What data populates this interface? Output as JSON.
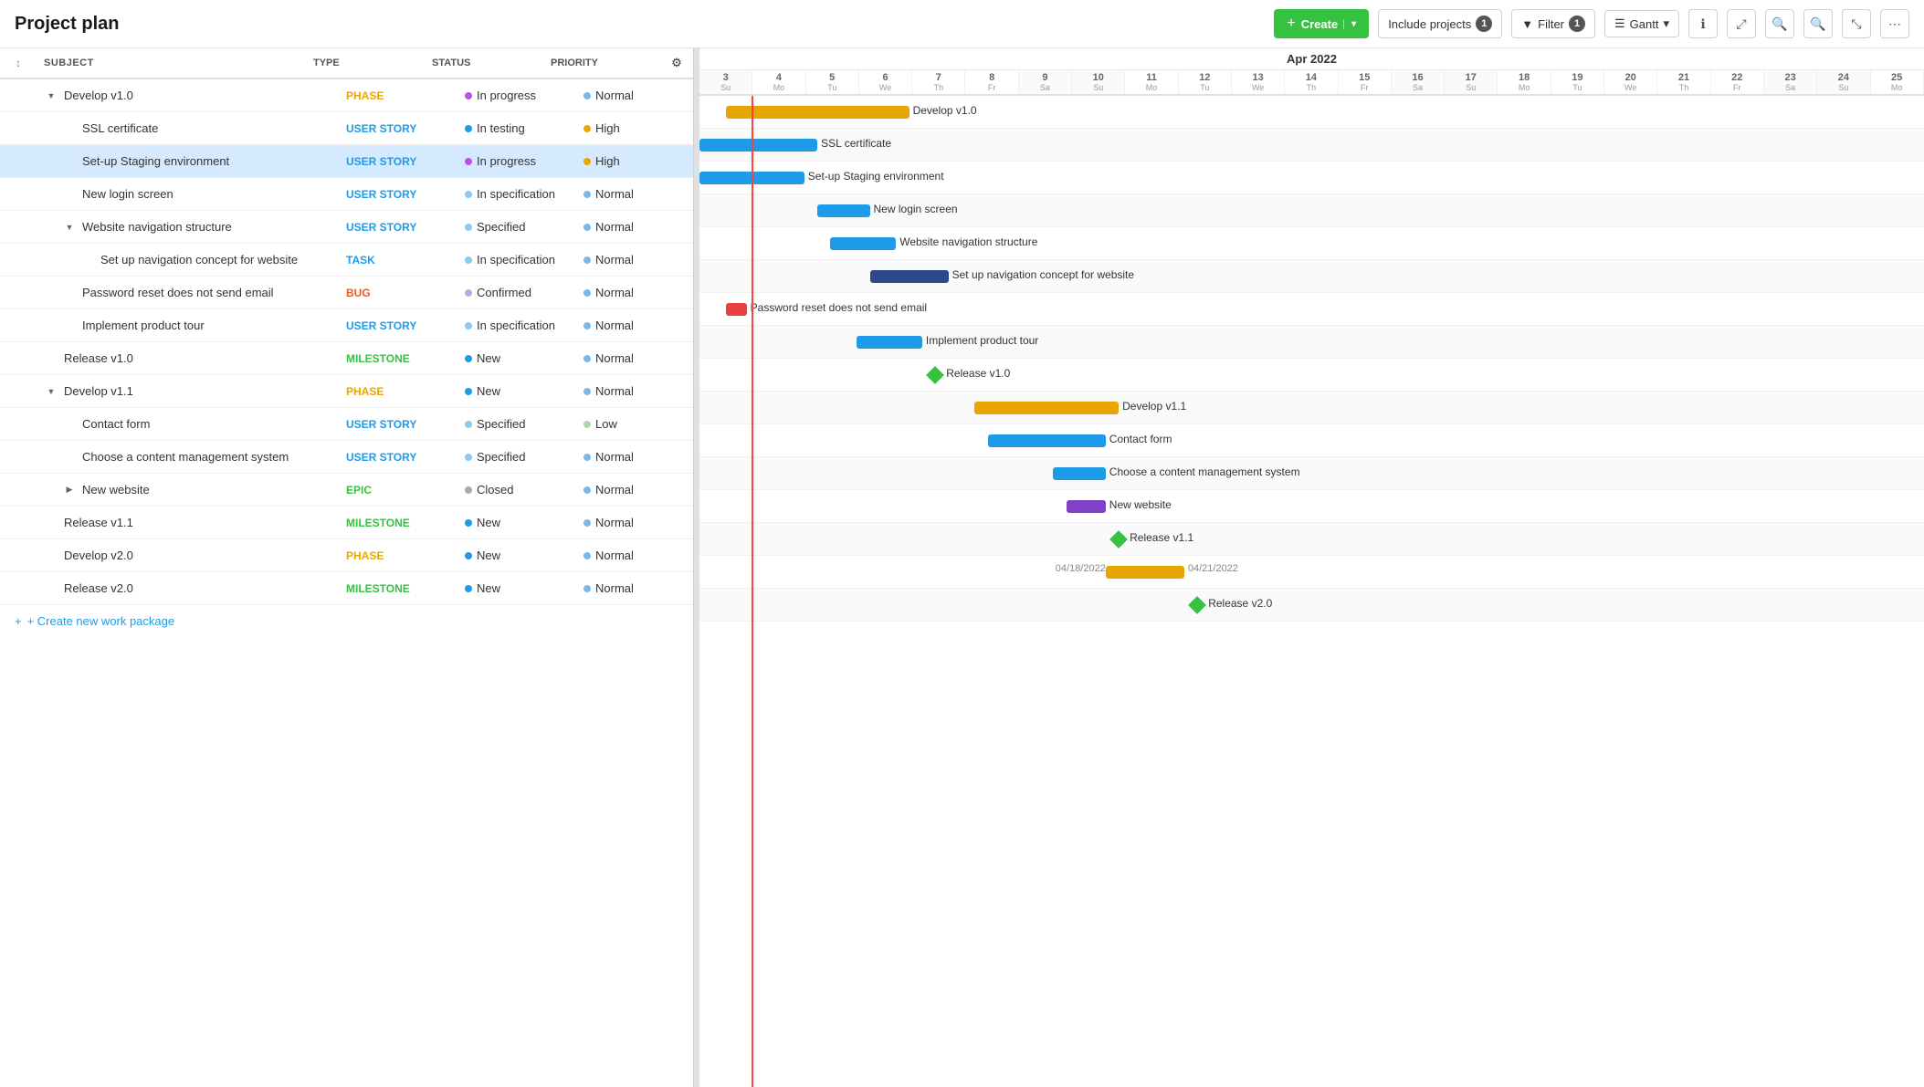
{
  "header": {
    "title": "Project plan",
    "create_label": "+ Create",
    "include_projects_label": "Include projects",
    "include_projects_count": "1",
    "filter_label": "Filter",
    "filter_count": "1",
    "gantt_label": "Gantt"
  },
  "columns": {
    "subject": "SUBJECT",
    "type": "TYPE",
    "status": "STATUS",
    "priority": "PRIORITY"
  },
  "tasks": [
    {
      "id": 1,
      "indent": 0,
      "toggle": "▼",
      "subject": "Develop v1.0",
      "type": "PHASE",
      "type_class": "type-phase",
      "status": "In progress",
      "status_dot": "status-dot-inprogress",
      "priority": "Normal",
      "priority_dot": "priority-normal",
      "selected": false
    },
    {
      "id": 2,
      "indent": 1,
      "toggle": "",
      "subject": "SSL certificate",
      "type": "USER STORY",
      "type_class": "type-user-story",
      "status": "In testing",
      "status_dot": "status-dot-intesting",
      "priority": "High",
      "priority_dot": "priority-high",
      "selected": false
    },
    {
      "id": 3,
      "indent": 1,
      "toggle": "",
      "subject": "Set-up Staging environment",
      "type": "USER STORY",
      "type_class": "type-user-story",
      "status": "In progress",
      "status_dot": "status-dot-inprogress",
      "priority": "High",
      "priority_dot": "priority-high",
      "selected": true
    },
    {
      "id": 4,
      "indent": 1,
      "toggle": "",
      "subject": "New login screen",
      "type": "USER STORY",
      "type_class": "type-user-story",
      "status": "In specification",
      "status_dot": "status-dot-inspec",
      "priority": "Normal",
      "priority_dot": "priority-normal",
      "selected": false
    },
    {
      "id": 5,
      "indent": 1,
      "toggle": "▼",
      "subject": "Website navigation structure",
      "type": "USER STORY",
      "type_class": "type-user-story",
      "status": "Specified",
      "status_dot": "status-dot-specified",
      "priority": "Normal",
      "priority_dot": "priority-normal",
      "selected": false
    },
    {
      "id": 6,
      "indent": 2,
      "toggle": "",
      "subject": "Set up navigation concept for website",
      "type": "TASK",
      "type_class": "type-task",
      "status": "In specification",
      "status_dot": "status-dot-inspec",
      "priority": "Normal",
      "priority_dot": "priority-normal",
      "selected": false
    },
    {
      "id": 7,
      "indent": 1,
      "toggle": "",
      "subject": "Password reset does not send email",
      "type": "BUG",
      "type_class": "type-bug",
      "status": "Confirmed",
      "status_dot": "status-dot-confirmed",
      "priority": "Normal",
      "priority_dot": "priority-normal",
      "selected": false
    },
    {
      "id": 8,
      "indent": 1,
      "toggle": "",
      "subject": "Implement product tour",
      "type": "USER STORY",
      "type_class": "type-user-story",
      "status": "In specification",
      "status_dot": "status-dot-inspec",
      "priority": "Normal",
      "priority_dot": "priority-normal",
      "selected": false
    },
    {
      "id": 9,
      "indent": 0,
      "toggle": "",
      "subject": "Release v1.0",
      "type": "MILESTONE",
      "type_class": "type-milestone",
      "status": "New",
      "status_dot": "status-dot-new",
      "priority": "Normal",
      "priority_dot": "priority-normal",
      "selected": false
    },
    {
      "id": 10,
      "indent": 0,
      "toggle": "▼",
      "subject": "Develop v1.1",
      "type": "PHASE",
      "type_class": "type-phase",
      "status": "New",
      "status_dot": "status-dot-new",
      "priority": "Normal",
      "priority_dot": "priority-normal",
      "selected": false
    },
    {
      "id": 11,
      "indent": 1,
      "toggle": "",
      "subject": "Contact form",
      "type": "USER STORY",
      "type_class": "type-user-story",
      "status": "Specified",
      "status_dot": "status-dot-specified",
      "priority": "Low",
      "priority_dot": "priority-low",
      "selected": false
    },
    {
      "id": 12,
      "indent": 1,
      "toggle": "",
      "subject": "Choose a content management system",
      "type": "USER STORY",
      "type_class": "type-user-story",
      "status": "Specified",
      "status_dot": "status-dot-specified",
      "priority": "Normal",
      "priority_dot": "priority-normal",
      "selected": false
    },
    {
      "id": 13,
      "indent": 1,
      "toggle": "▶",
      "subject": "New website",
      "type": "EPIC",
      "type_class": "type-epic",
      "status": "Closed",
      "status_dot": "status-dot-closed",
      "priority": "Normal",
      "priority_dot": "priority-normal",
      "selected": false
    },
    {
      "id": 14,
      "indent": 0,
      "toggle": "",
      "subject": "Release v1.1",
      "type": "MILESTONE",
      "type_class": "type-milestone",
      "status": "New",
      "status_dot": "status-dot-new",
      "priority": "Normal",
      "priority_dot": "priority-normal",
      "selected": false
    },
    {
      "id": 15,
      "indent": 0,
      "toggle": "",
      "subject": "Develop v2.0",
      "type": "PHASE",
      "type_class": "type-phase",
      "status": "New",
      "status_dot": "status-dot-new",
      "priority": "Normal",
      "priority_dot": "priority-normal",
      "selected": false
    },
    {
      "id": 16,
      "indent": 0,
      "toggle": "",
      "subject": "Release v2.0",
      "type": "MILESTONE",
      "type_class": "type-milestone",
      "status": "New",
      "status_dot": "status-dot-new",
      "priority": "Normal",
      "priority_dot": "priority-normal",
      "selected": false
    }
  ],
  "create_link": "+ Create new work package",
  "gantt": {
    "month": "Apr 2022",
    "date_start": "04/18/2022",
    "date_end": "04/21/2022"
  }
}
